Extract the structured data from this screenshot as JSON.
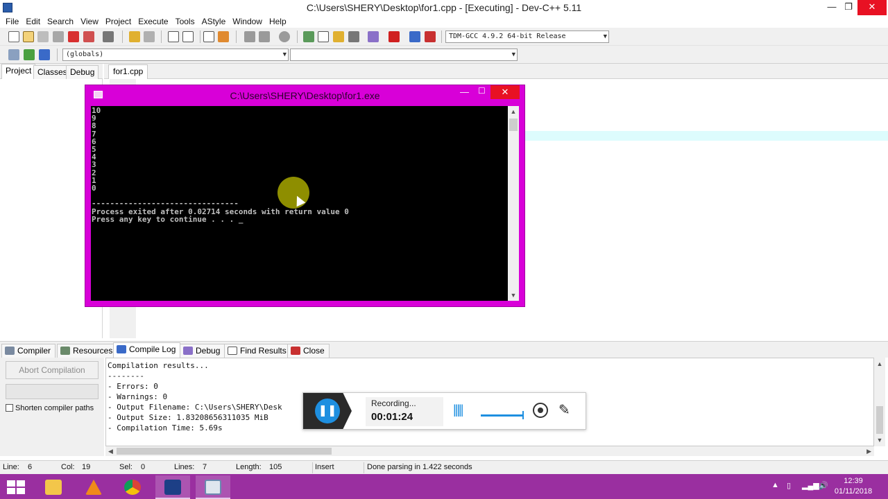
{
  "window": {
    "title": "C:\\Users\\SHERY\\Desktop\\for1.cpp - [Executing] - Dev-C++ 5.11",
    "minimize": "—",
    "restore": "❐",
    "close": "✕"
  },
  "menu": [
    "File",
    "Edit",
    "Search",
    "View",
    "Project",
    "Execute",
    "Tools",
    "AStyle",
    "Window",
    "Help"
  ],
  "toolbar": {
    "compiler_select": "TDM-GCC 4.9.2 64-bit Release",
    "scope_select": "(globals)",
    "function_select": ""
  },
  "left_panel": {
    "tabs": [
      "Project",
      "Classes",
      "Debug"
    ]
  },
  "editor": {
    "tab": "for1.cpp"
  },
  "console": {
    "title": "C:\\Users\\SHERY\\Desktop\\for1.exe",
    "output_numbers": [
      "10",
      "9",
      "8",
      "7",
      "6",
      "5",
      "4",
      "3",
      "2",
      "1",
      "0"
    ],
    "separator": "--------------------------------",
    "exit_line": "Process exited after 0.02714 seconds with return value 0",
    "prompt_line": "Press any key to continue . . . _"
  },
  "bottom_tabs": [
    "Compiler",
    "Resources",
    "Compile Log",
    "Debug",
    "Find Results",
    "Close"
  ],
  "compile_panel": {
    "abort_button": "Abort Compilation",
    "shorten_label": "Shorten compiler paths",
    "log_lines": [
      "Compilation results...",
      "--------",
      "- Errors: 0",
      "- Warnings: 0",
      "- Output Filename: C:\\Users\\SHERY\\Desk",
      "- Output Size: 1.83208656311035 MiB",
      "- Compilation Time: 5.69s"
    ]
  },
  "recorder": {
    "status": "Recording...",
    "time": "00:01:24"
  },
  "statusbar": {
    "line_label": "Line:",
    "line_value": "6",
    "col_label": "Col:",
    "col_value": "19",
    "sel_label": "Sel:",
    "sel_value": "0",
    "lines_label": "Lines:",
    "lines_value": "7",
    "length_label": "Length:",
    "length_value": "105",
    "mode": "Insert",
    "message": "Done parsing in 1.422 seconds"
  },
  "taskbar": {
    "time": "12:39",
    "date": "01/11/2018"
  },
  "colors": {
    "console_frame": "#d800d8",
    "taskbar": "#9a2fa0",
    "accent_blue": "#1e8fe0"
  }
}
